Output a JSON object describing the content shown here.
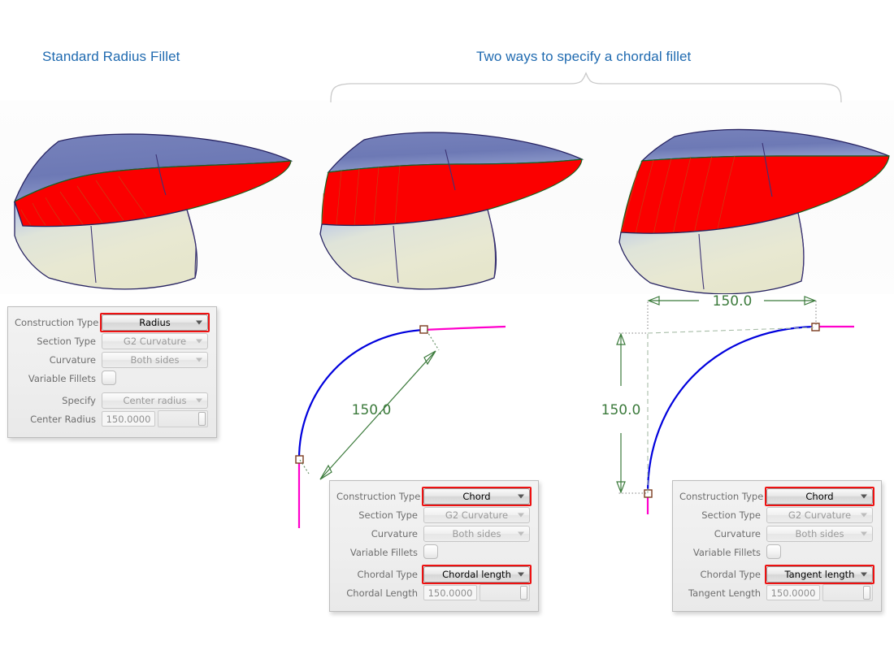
{
  "headings": {
    "standard": "Standard Radius Fillet",
    "chordal": "Two ways to specify a chordal fillet"
  },
  "dimension_labels": {
    "radius_value": "150.0",
    "chord_value": "150.0",
    "tangent_horizontal": "150.0",
    "tangent_vertical": "150.0"
  },
  "panels": [
    {
      "id": "radius-panel",
      "rows": [
        {
          "label": "Construction Type",
          "type": "combo",
          "value": "Radius",
          "highlighted": true,
          "enabled": true
        },
        {
          "label": "Section Type",
          "type": "combo",
          "value": "G2 Curvature",
          "highlighted": false,
          "enabled": false
        },
        {
          "label": "Curvature",
          "type": "combo",
          "value": "Both sides",
          "highlighted": false,
          "enabled": false
        },
        {
          "label": "Variable Fillets",
          "type": "checkbox",
          "value": "",
          "checked": false
        },
        {
          "label": "Specify",
          "type": "combo",
          "value": "Center radius",
          "highlighted": false,
          "enabled": false
        },
        {
          "label": "Center Radius",
          "type": "number",
          "value": "150.0000"
        }
      ]
    },
    {
      "id": "chord-length-panel",
      "rows": [
        {
          "label": "Construction Type",
          "type": "combo",
          "value": "Chord",
          "highlighted": true,
          "enabled": true
        },
        {
          "label": "Section Type",
          "type": "combo",
          "value": "G2 Curvature",
          "highlighted": false,
          "enabled": false
        },
        {
          "label": "Curvature",
          "type": "combo",
          "value": "Both sides",
          "highlighted": false,
          "enabled": false
        },
        {
          "label": "Variable Fillets",
          "type": "checkbox",
          "value": "",
          "checked": false
        },
        {
          "label": "Chordal Type",
          "type": "combo",
          "value": "Chordal length",
          "highlighted": true,
          "enabled": true
        },
        {
          "label": "Chordal Length",
          "type": "number",
          "value": "150.0000"
        }
      ]
    },
    {
      "id": "tangent-length-panel",
      "rows": [
        {
          "label": "Construction Type",
          "type": "combo",
          "value": "Chord",
          "highlighted": true,
          "enabled": true
        },
        {
          "label": "Section Type",
          "type": "combo",
          "value": "G2 Curvature",
          "highlighted": false,
          "enabled": false
        },
        {
          "label": "Curvature",
          "type": "combo",
          "value": "Both sides",
          "highlighted": false,
          "enabled": false
        },
        {
          "label": "Variable Fillets",
          "type": "checkbox",
          "value": "",
          "checked": false
        },
        {
          "label": "Chordal Type",
          "type": "combo",
          "value": "Tangent length",
          "highlighted": true,
          "enabled": true
        },
        {
          "label": "Tangent Length",
          "type": "number",
          "value": "150.0000"
        }
      ]
    }
  ],
  "colors": {
    "heading": "#1f6ab0",
    "fillet_surface": "#ff0000",
    "top_surface": "#6a76b4",
    "bottom_surface": "#e4e4cc",
    "curve_blue": "#0000dd",
    "curve_magenta": "#ff00cc",
    "dimension_green": "#3b7a3b",
    "highlight_red": "#ee1111"
  },
  "icons": {
    "dropdown": "chevron-down-icon",
    "brace": "curly-brace-icon"
  }
}
